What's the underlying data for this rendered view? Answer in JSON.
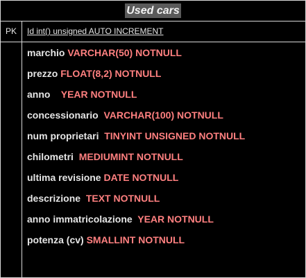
{
  "entity": {
    "title": "Used cars",
    "pk_label": "PK",
    "pk_field": "Id int()  unsigned AUTO INCREMENT",
    "attributes": [
      {
        "name": "marchio ",
        "type": "VARCHAR(50) NOTNULL"
      },
      {
        "name": "prezzo ",
        "type": "FLOAT(8,2) NOTNULL"
      },
      {
        "name": "anno    ",
        "type": "YEAR NOTNULL"
      },
      {
        "name": "concessionario  ",
        "type": "VARCHAR(100) NOTNULL"
      },
      {
        "name": "num proprietari  ",
        "type": "TINYINT UNSIGNED NOTNULL"
      },
      {
        "name": "chilometri  ",
        "type": "MEDIUMINT NOTNULL"
      },
      {
        "name": "ultima revisione ",
        "type": "DATE NOTNULL"
      },
      {
        "name": "descrizione  ",
        "type": "TEXT NOTNULL"
      },
      {
        "name": "anno immatricolazione  ",
        "type": "YEAR NOTNULL"
      },
      {
        "name": "potenza (cv) ",
        "type": "SMALLINT NOTNULL"
      }
    ]
  },
  "colors": {
    "background": "#000000",
    "border": "#d9d9d9",
    "text": "#e6e6e6",
    "type_text": "#ff8080",
    "title_highlight": "#5a5a5a"
  }
}
